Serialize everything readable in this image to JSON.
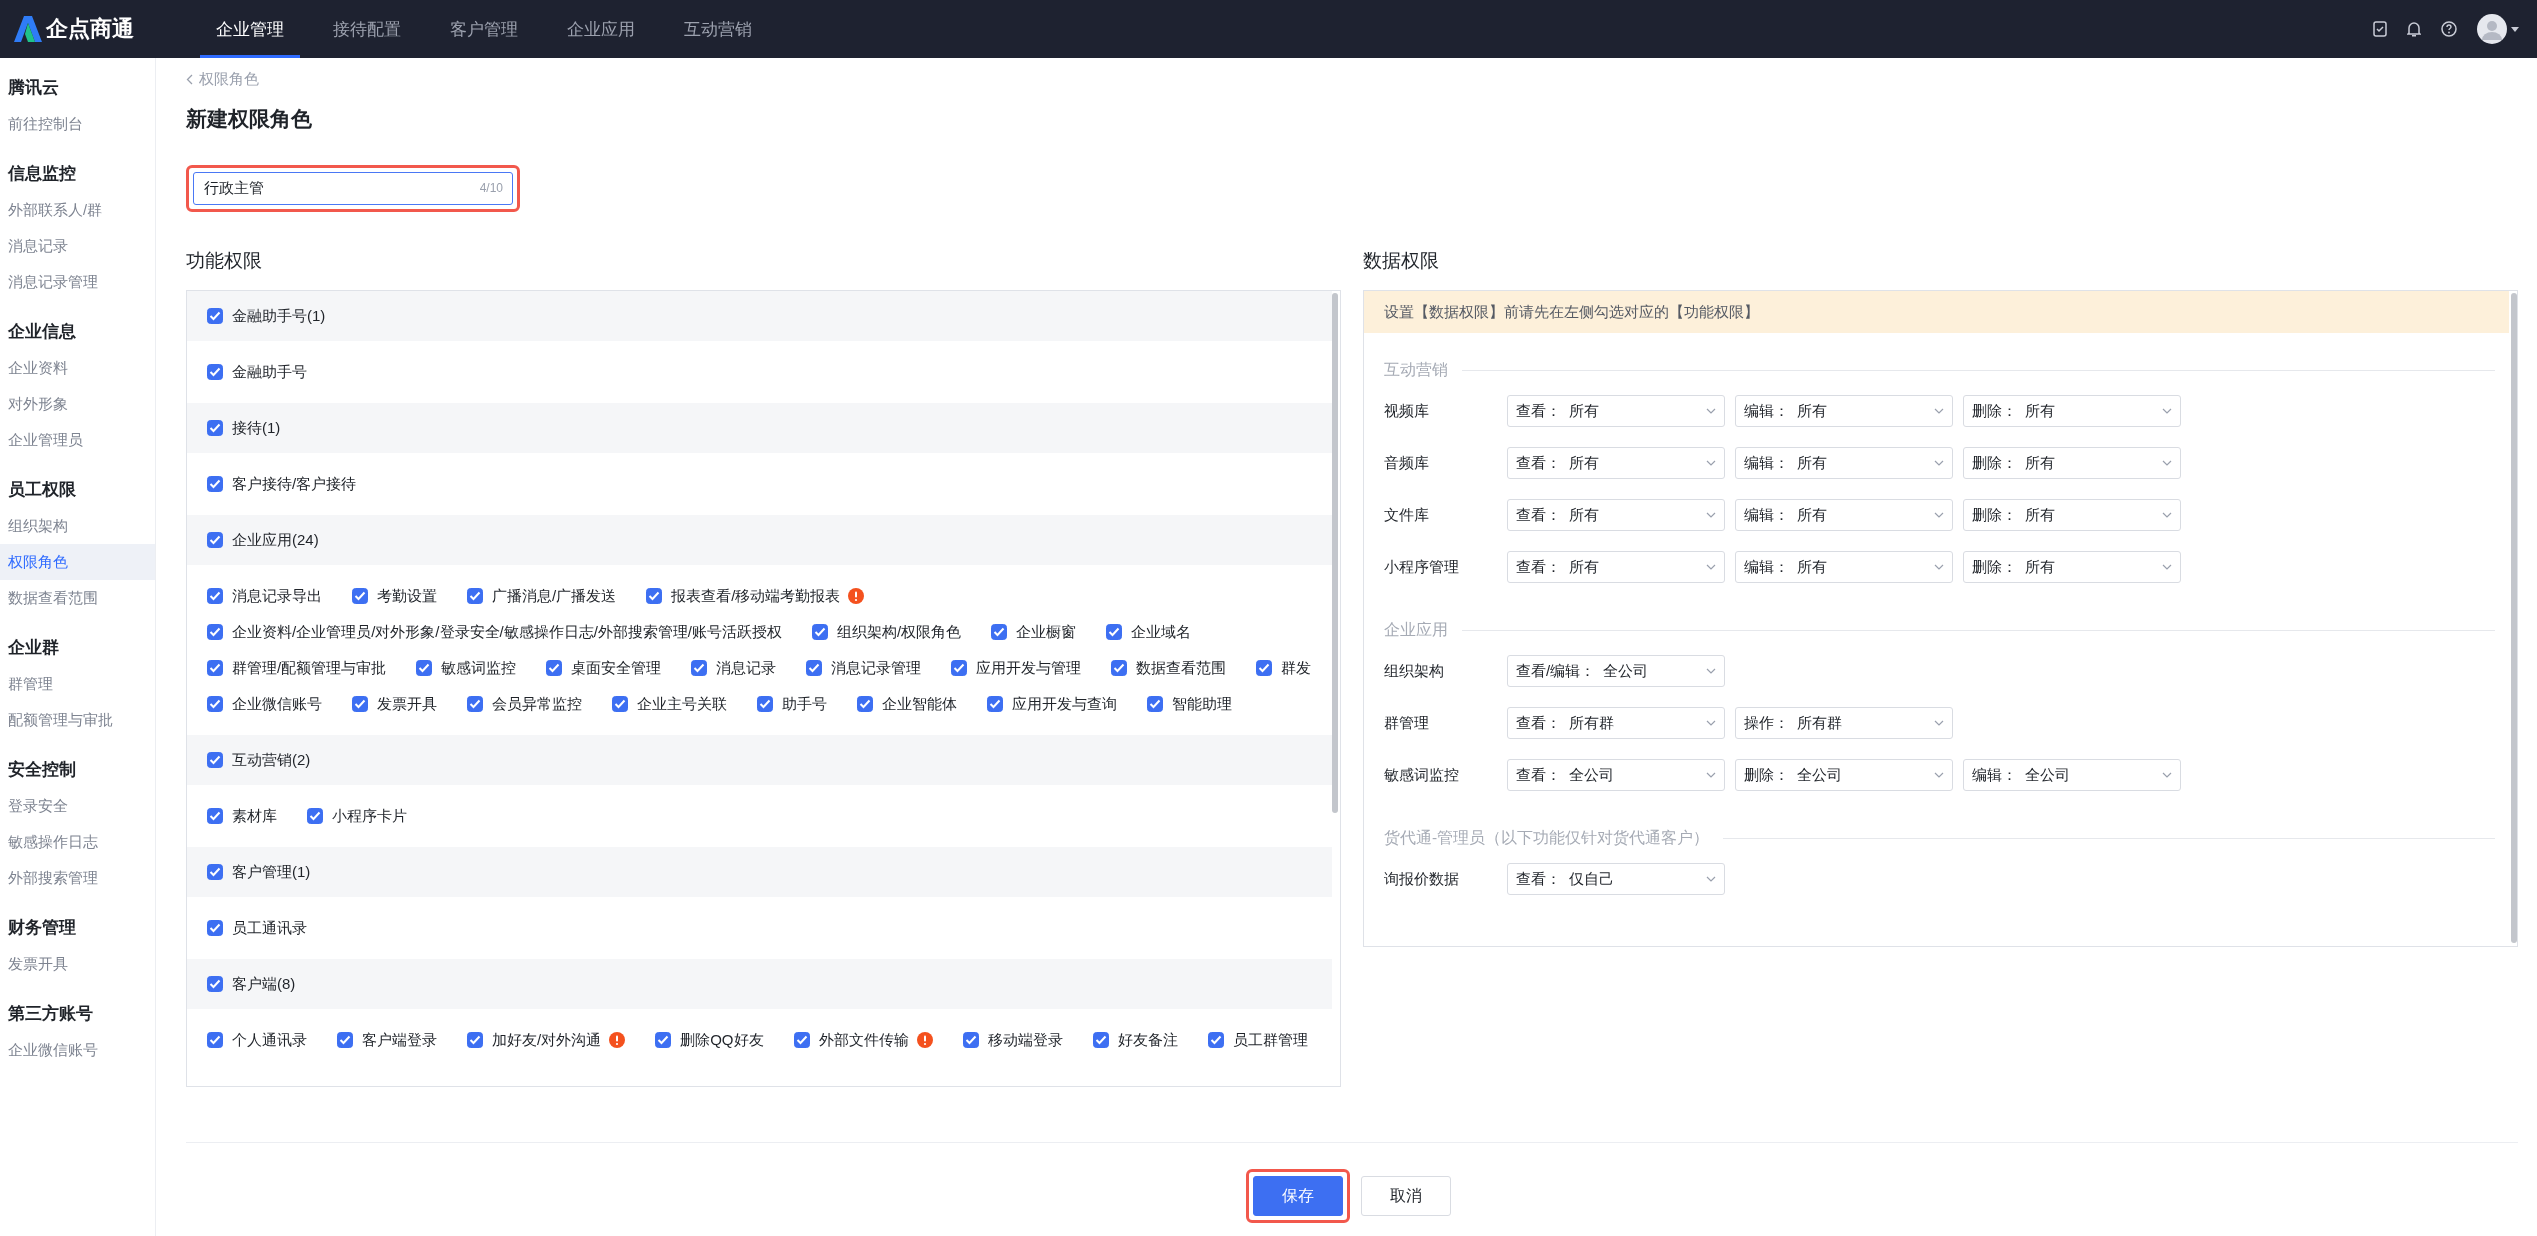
{
  "top_bar": {
    "logo_text": "企点商通",
    "tabs": [
      {
        "label": "企业管理",
        "selected": true
      },
      {
        "label": "接待配置",
        "selected": false
      },
      {
        "label": "客户管理",
        "selected": false
      },
      {
        "label": "企业应用",
        "selected": false
      },
      {
        "label": "互动营销",
        "selected": false
      }
    ]
  },
  "sidebar": {
    "sections": [
      {
        "title": "腾讯云",
        "items": [
          {
            "label": "前往控制台",
            "selected": false
          }
        ]
      },
      {
        "title": "信息监控",
        "items": [
          {
            "label": "外部联系人/群",
            "selected": false
          },
          {
            "label": "消息记录",
            "selected": false
          },
          {
            "label": "消息记录管理",
            "selected": false
          }
        ]
      },
      {
        "title": "企业信息",
        "items": [
          {
            "label": "企业资料",
            "selected": false
          },
          {
            "label": "对外形象",
            "selected": false
          },
          {
            "label": "企业管理员",
            "selected": false
          }
        ]
      },
      {
        "title": "员工权限",
        "items": [
          {
            "label": "组织架构",
            "selected": false
          },
          {
            "label": "权限角色",
            "selected": true
          },
          {
            "label": "数据查看范围",
            "selected": false
          }
        ]
      },
      {
        "title": "企业群",
        "items": [
          {
            "label": "群管理",
            "selected": false
          },
          {
            "label": "配额管理与审批",
            "selected": false
          }
        ]
      },
      {
        "title": "安全控制",
        "items": [
          {
            "label": "登录安全",
            "selected": false
          },
          {
            "label": "敏感操作日志",
            "selected": false
          },
          {
            "label": "外部搜索管理",
            "selected": false
          }
        ]
      },
      {
        "title": "财务管理",
        "items": [
          {
            "label": "发票开具",
            "selected": false
          }
        ]
      },
      {
        "title": "第三方账号",
        "items": [
          {
            "label": "企业微信账号",
            "selected": false
          }
        ]
      }
    ]
  },
  "breadcrumb": "权限角色",
  "title": "新建权限角色",
  "role_name": {
    "value": "行政主管",
    "counter": "4/10",
    "highlighted": true
  },
  "function_permissions": {
    "title": "功能权限",
    "groups": [
      {
        "label": "金融助手号(1)",
        "checked": true,
        "items": [
          {
            "label": "金融助手号",
            "checked": true,
            "warning": false
          }
        ]
      },
      {
        "label": "接待(1)",
        "checked": true,
        "items": [
          {
            "label": "客户接待/客户接待",
            "checked": true,
            "warning": false
          }
        ]
      },
      {
        "label": "企业应用(24)",
        "checked": true,
        "items": [
          {
            "label": "消息记录导出",
            "checked": true,
            "warning": false
          },
          {
            "label": "考勤设置",
            "checked": true,
            "warning": false
          },
          {
            "label": "广播消息/广播发送",
            "checked": true,
            "warning": false
          },
          {
            "label": "报表查看/移动端考勤报表",
            "checked": true,
            "warning": true
          },
          {
            "label": "企业资料/企业管理员/对外形象/登录安全/敏感操作日志/外部搜索管理/账号活跃授权",
            "checked": true,
            "warning": false
          },
          {
            "label": "组织架构/权限角色",
            "checked": true,
            "warning": false
          },
          {
            "label": "企业橱窗",
            "checked": true,
            "warning": false
          },
          {
            "label": "企业域名",
            "checked": true,
            "warning": false
          },
          {
            "label": "群管理/配额管理与审批",
            "checked": true,
            "warning": false
          },
          {
            "label": "敏感词监控",
            "checked": true,
            "warning": false
          },
          {
            "label": "桌面安全管理",
            "checked": true,
            "warning": false
          },
          {
            "label": "消息记录",
            "checked": true,
            "warning": false
          },
          {
            "label": "消息记录管理",
            "checked": true,
            "warning": false
          },
          {
            "label": "应用开发与管理",
            "checked": true,
            "warning": false
          },
          {
            "label": "数据查看范围",
            "checked": true,
            "warning": false
          },
          {
            "label": "群发",
            "checked": true,
            "warning": false
          },
          {
            "label": "企业微信账号",
            "checked": true,
            "warning": false
          },
          {
            "label": "发票开具",
            "checked": true,
            "warning": false
          },
          {
            "label": "会员异常监控",
            "checked": true,
            "warning": false
          },
          {
            "label": "企业主号关联",
            "checked": true,
            "warning": false
          },
          {
            "label": "助手号",
            "checked": true,
            "warning": false
          },
          {
            "label": "企业智能体",
            "checked": true,
            "warning": false
          },
          {
            "label": "应用开发与查询",
            "checked": true,
            "warning": false
          },
          {
            "label": "智能助理",
            "checked": true,
            "warning": false
          }
        ]
      },
      {
        "label": "互动营销(2)",
        "checked": true,
        "items": [
          {
            "label": "素材库",
            "checked": true,
            "warning": false
          },
          {
            "label": "小程序卡片",
            "checked": true,
            "warning": false
          }
        ]
      },
      {
        "label": "客户管理(1)",
        "checked": true,
        "items": [
          {
            "label": "员工通讯录",
            "checked": true,
            "warning": false
          }
        ]
      },
      {
        "label": "客户端(8)",
        "checked": true,
        "items": [
          {
            "label": "个人通讯录",
            "checked": true,
            "warning": false
          },
          {
            "label": "客户端登录",
            "checked": true,
            "warning": false
          },
          {
            "label": "加好友/对外沟通",
            "checked": true,
            "warning": true
          },
          {
            "label": "删除QQ好友",
            "checked": true,
            "warning": false
          },
          {
            "label": "外部文件传输",
            "checked": true,
            "warning": true
          },
          {
            "label": "移动端登录",
            "checked": true,
            "warning": false
          },
          {
            "label": "好友备注",
            "checked": true,
            "warning": false
          },
          {
            "label": "员工群管理",
            "checked": true,
            "warning": false
          }
        ]
      }
    ]
  },
  "data_permissions": {
    "title": "数据权限",
    "notice": "设置【数据权限】前请先在左侧勾选对应的【功能权限】",
    "sections": [
      {
        "title": "互动营销",
        "rows": [
          {
            "label": "视频库",
            "selects": [
              {
                "prefix": "查看：",
                "value": "所有"
              },
              {
                "prefix": "编辑：",
                "value": "所有"
              },
              {
                "prefix": "删除：",
                "value": "所有"
              }
            ]
          },
          {
            "label": "音频库",
            "selects": [
              {
                "prefix": "查看：",
                "value": "所有"
              },
              {
                "prefix": "编辑：",
                "value": "所有"
              },
              {
                "prefix": "删除：",
                "value": "所有"
              }
            ]
          },
          {
            "label": "文件库",
            "selects": [
              {
                "prefix": "查看：",
                "value": "所有"
              },
              {
                "prefix": "编辑：",
                "value": "所有"
              },
              {
                "prefix": "删除：",
                "value": "所有"
              }
            ]
          },
          {
            "label": "小程序管理",
            "selects": [
              {
                "prefix": "查看：",
                "value": "所有"
              },
              {
                "prefix": "编辑：",
                "value": "所有"
              },
              {
                "prefix": "删除：",
                "value": "所有"
              }
            ]
          }
        ]
      },
      {
        "title": "企业应用",
        "rows": [
          {
            "label": "组织架构",
            "selects": [
              {
                "prefix": "查看/编辑：",
                "value": "全公司"
              }
            ]
          },
          {
            "label": "群管理",
            "selects": [
              {
                "prefix": "查看：",
                "value": "所有群"
              },
              {
                "prefix": "操作：",
                "value": "所有群"
              }
            ]
          },
          {
            "label": "敏感词监控",
            "selects": [
              {
                "prefix": "查看：",
                "value": "全公司"
              },
              {
                "prefix": "删除：",
                "value": "全公司"
              },
              {
                "prefix": "编辑：",
                "value": "全公司"
              }
            ]
          }
        ]
      },
      {
        "title": "货代通-管理员（以下功能仅针对货代通客户）",
        "rows": [
          {
            "label": "询报价数据",
            "selects": [
              {
                "prefix": "查看：",
                "value": "仅自己"
              }
            ]
          }
        ]
      }
    ]
  },
  "buttons": [
    {
      "label": "保存",
      "kind": "primary",
      "highlighted": true
    },
    {
      "label": "取消",
      "kind": "default",
      "highlighted": false
    }
  ]
}
